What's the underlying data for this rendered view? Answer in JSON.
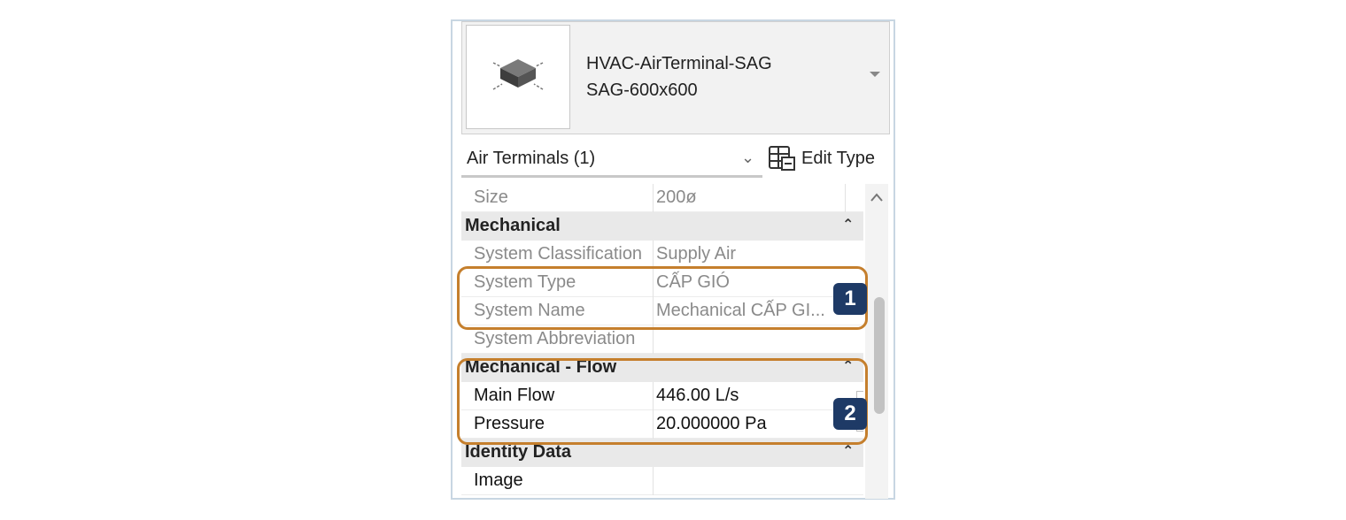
{
  "type_selector": {
    "family": "HVAC-AirTerminal-SAG",
    "type": "SAG-600x600"
  },
  "filter": {
    "label": "Air Terminals (1)",
    "edit_type_label": "Edit Type"
  },
  "properties": {
    "size": {
      "name": "Size",
      "value": "200ø"
    },
    "groups": {
      "mechanical": "Mechanical",
      "mechanical_flow": "Mechanical - Flow",
      "identity_data": "Identity Data"
    },
    "rows": {
      "system_classification": {
        "name": "System Classification",
        "value": "Supply Air"
      },
      "system_type": {
        "name": "System Type",
        "value": "CẤP GIÓ"
      },
      "system_name": {
        "name": "System Name",
        "value": "Mechanical CẤP GI..."
      },
      "system_abbreviation": {
        "name": "System Abbreviation",
        "value": ""
      },
      "main_flow": {
        "name": "Main Flow",
        "value": "446.00 L/s"
      },
      "pressure": {
        "name": "Pressure",
        "value": "20.000000 Pa"
      },
      "image": {
        "name": "Image",
        "value": ""
      }
    }
  },
  "callouts": {
    "one": "1",
    "two": "2"
  },
  "colors": {
    "highlight": "#c57f2d",
    "callout_bg": "#1e3a66"
  }
}
